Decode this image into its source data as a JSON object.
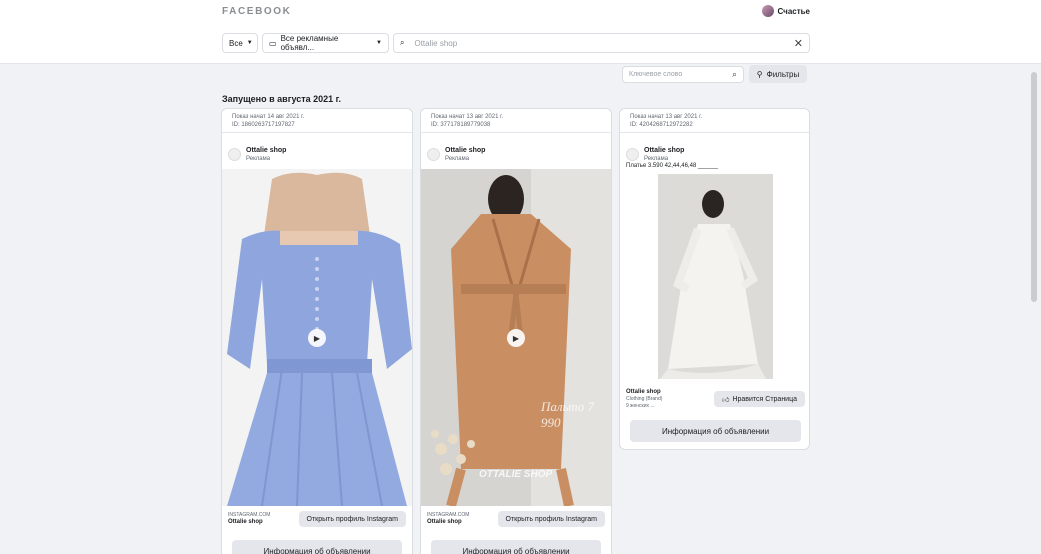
{
  "header": {
    "brand": "FACEBOOK",
    "user_name": "Счастье"
  },
  "search": {
    "scope_label": "Все",
    "ad_type_label": "Все рекламные объявл...",
    "query_value": "Ottalie shop"
  },
  "filters": {
    "keyword_placeholder": "Ключевое слово",
    "filter_button": "Фильтры"
  },
  "results": {
    "launched_heading": "Запущено в августа 2021 г."
  },
  "ads": [
    {
      "status_line": "Показ начат 14 авг 2021 г.",
      "id_line": "ID: 1860263717197827",
      "advertiser": "Ottalie shop",
      "sponsored": "Реклама",
      "source_domain": "INSTAGRAM.COM",
      "source_name": "Ottalie shop",
      "cta": "Открыть профиль Instagram",
      "info_button": "Информация об объявлении"
    },
    {
      "status_line": "Показ начат 13 авг 2021 г.",
      "id_line": "ID: 377178189779038",
      "advertiser": "Ottalie shop",
      "sponsored": "Реклама",
      "source_domain": "INSTAGRAM.COM",
      "source_name": "Ottalie shop",
      "cta": "Открыть профиль Instagram",
      "info_button": "Информация об объявлении",
      "watermark_price": "Пальто 7 990",
      "watermark_brand": "OTTALIE SHOP"
    },
    {
      "status_line": "Показ начат 13 авг 2021 г.",
      "id_line": "ID: 4204268712972282",
      "advertiser": "Ottalie shop",
      "sponsored": "Реклама",
      "caption": "Платье 3.590 42,44,46,48 ______",
      "page_name": "Ottalie shop",
      "page_category": "Clothing (Brand)",
      "page_likes": "9 женских ...",
      "cta": "Нравится Страница",
      "info_button": "Информация об объявлении"
    }
  ],
  "icons": {
    "avatar": "user-avatar",
    "search": "magnifier-icon",
    "filter": "sliders-icon",
    "like": "thumbs-up-icon",
    "play": "play-icon"
  },
  "colors": {
    "page_bg": "#f0f2f5",
    "card_bg": "#ffffff",
    "button_bg": "#e4e6eb"
  }
}
